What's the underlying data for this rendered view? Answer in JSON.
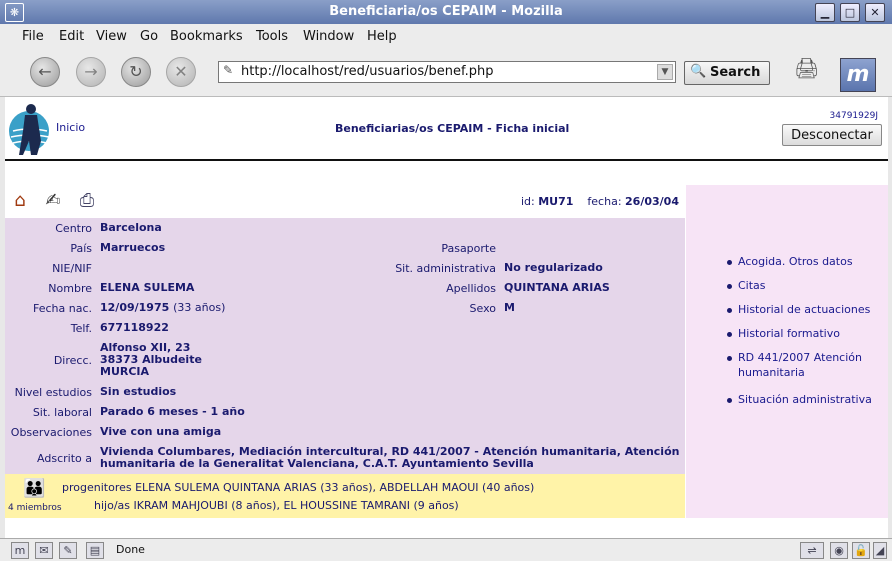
{
  "window": {
    "title": "Beneficiaria/os CEPAIM - Mozilla",
    "minimize_glyph": "▁",
    "maximize_glyph": "□",
    "close_glyph": "✕"
  },
  "menu": [
    "File",
    "Edit",
    "View",
    "Go",
    "Bookmarks",
    "Tools",
    "Window",
    "Help"
  ],
  "toolbar": {
    "url": "http://localhost/red/usuarios/benef.php",
    "search_label": "Search"
  },
  "header": {
    "inicio": "Inicio",
    "page_title": "Beneficiarias/os CEPAIM - Ficha inicial",
    "user_id": "34791929J",
    "disconnect": "Desconectar"
  },
  "record": {
    "id_label": "id:",
    "id_value": "MU71",
    "fecha_label": "fecha:",
    "fecha_value": "26/03/04"
  },
  "fields": {
    "centro": {
      "label": "Centro",
      "value": "Barcelona"
    },
    "pais": {
      "label": "País",
      "value": "Marruecos"
    },
    "pasaporte": {
      "label": "Pasaporte",
      "value": ""
    },
    "nie": {
      "label": "NIE/NIF",
      "value": ""
    },
    "sit_admin": {
      "label": "Sit. administrativa",
      "value": "No regularizado"
    },
    "nombre": {
      "label": "Nombre",
      "value": "ELENA SULEMA"
    },
    "apellidos": {
      "label": "Apellidos",
      "value": "QUINTANA ARIAS"
    },
    "fecha_nac": {
      "label": "Fecha nac.",
      "value": "12/09/1975",
      "extra": "(33 años)"
    },
    "sexo": {
      "label": "Sexo",
      "value": "M"
    },
    "telf": {
      "label": "Telf.",
      "value": "677118922"
    },
    "direcc": {
      "label": "Direcc.",
      "line1": "Alfonso XII, 23",
      "line2": "38373 Albudeite",
      "line3": "MURCIA"
    },
    "nivel": {
      "label": "Nivel estudios",
      "value": "Sin estudios"
    },
    "sit_laboral": {
      "label": "Sit. laboral",
      "value": "Parado 6 meses - 1 año"
    },
    "observaciones": {
      "label": "Observaciones",
      "value": "Vive con una amiga"
    },
    "adscrito": {
      "label": "Adscrito a",
      "line1": "Vivienda Columbares, Mediación intercultural, RD 441/2007 - Atención humanitaria, Atención",
      "line2": "humanitaria de la Generalitat Valenciana, C.A.T. Ayuntamiento Sevilla"
    }
  },
  "family": {
    "count": "4 miembros",
    "parents_label": "progenitores",
    "parents": "ELENA SULEMA QUINTANA ARIAS (33 años), ABDELLAH MAOUI (40 años)",
    "children_label": "hijo/as",
    "children": "IKRAM MAHJOUBI (8 años), EL HOUSSINE TAMRANI (9 años)"
  },
  "sidebar_links": [
    "Acogida. Otros datos",
    "Citas",
    "Historial de actuaciones",
    "Historial formativo",
    "RD 441/2007 Atención humanitaria",
    "Situación administrativa"
  ],
  "status": {
    "text": "Done"
  },
  "icons": {
    "home": "home-icon",
    "edit": "edit-icon",
    "print": "print-icon",
    "family": "family-icon"
  }
}
